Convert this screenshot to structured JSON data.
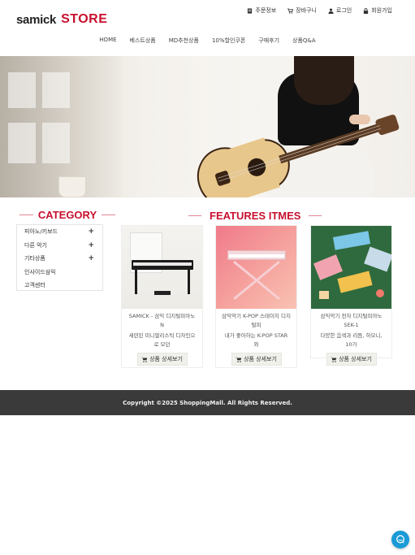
{
  "brand": {
    "part1": "samick",
    "part2": "STORE",
    "accent_color": "#c8102e"
  },
  "util_nav": [
    {
      "label": "주문정보",
      "icon": "receipt-icon"
    },
    {
      "label": "장바구니",
      "icon": "cart-icon"
    },
    {
      "label": "로그인",
      "icon": "user-icon"
    },
    {
      "label": "회원가입",
      "icon": "lock-icon"
    }
  ],
  "main_nav": [
    "HOME",
    "베스트상품",
    "MD추천상품",
    "10%할인쿠폰",
    "구매후기",
    "상품Q&A"
  ],
  "category": {
    "title": "CATEGORY",
    "items": [
      {
        "label": "피아노/키보드",
        "has_children": true
      },
      {
        "label": "다른 악기",
        "has_children": true
      },
      {
        "label": "기타상품",
        "has_children": true
      },
      {
        "label": "인사이드삼익",
        "has_children": false
      },
      {
        "label": "고객센터",
        "has_children": false
      }
    ],
    "expand_symbol": "+"
  },
  "features": {
    "title": "FEATURES ITMES",
    "button_label": "상품 상세보기",
    "products": [
      {
        "name": "SAMICK - 삼익 디지털피아노 N",
        "desc": "세련된 미니멀리스틱 디자인으로 모던",
        "image": "black-digital-piano-image"
      },
      {
        "name": "삼익악기 K-POP 스테이지 디지털피",
        "desc": "내가 좋아하는 K-POP STAR와",
        "image": "pink-keyboard-on-stand-image"
      },
      {
        "name": "삼익악기 전자 디지털피아노 SEK-1",
        "desc": "다양한 음색과 리듬, 하모니, 10가",
        "image": "colorful-keyboards-image"
      }
    ]
  },
  "footer": {
    "copyright": "Copyright ©2025 ShoppingMall. All Rights Reserved."
  },
  "chat": {
    "icon": "chat-icon",
    "color": "#1a9bd7"
  }
}
